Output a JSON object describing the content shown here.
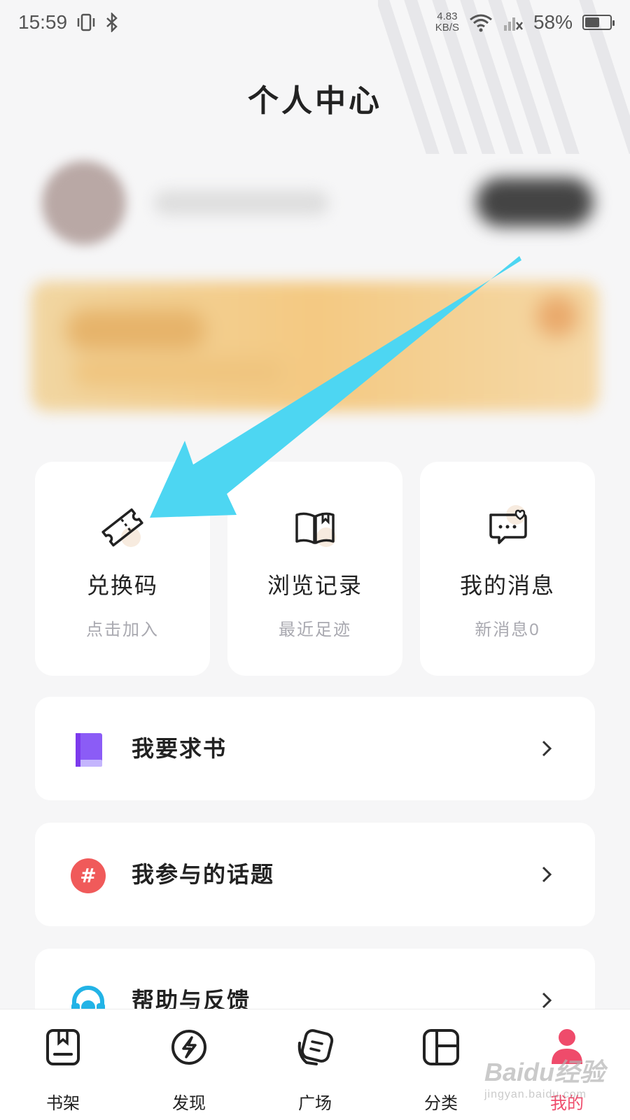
{
  "status_bar": {
    "time": "15:59",
    "speed_value": "4.83",
    "speed_unit": "KB/S",
    "battery": "58%",
    "battery_level": 0.58,
    "icons": [
      "vibrate-icon",
      "bluetooth-icon",
      "wifi-icon",
      "no-signal-icon",
      "battery-icon"
    ]
  },
  "header": {
    "title": "个人中心"
  },
  "quick_cards": [
    {
      "title": "兑换码",
      "subtitle": "点击加入",
      "icon": "ticket-icon"
    },
    {
      "title": "浏览记录",
      "subtitle": "最近足迹",
      "icon": "open-book-icon"
    },
    {
      "title": "我的消息",
      "subtitle": "新消息0",
      "icon": "chat-heart-icon"
    }
  ],
  "menu_items": [
    {
      "label": "我要求书",
      "icon": "purple-book-icon"
    },
    {
      "label": "我参与的话题",
      "icon": "hashtag-icon"
    },
    {
      "label": "帮助与反馈",
      "icon": "headset-icon"
    }
  ],
  "tab_bar": {
    "items": [
      {
        "label": "书架",
        "icon": "bookshelf-icon"
      },
      {
        "label": "发现",
        "icon": "discover-icon"
      },
      {
        "label": "广场",
        "icon": "square-icon"
      },
      {
        "label": "分类",
        "icon": "category-icon"
      },
      {
        "label": "我的",
        "icon": "profile-icon"
      }
    ],
    "active": "我的"
  },
  "colors": {
    "accent": "#ef4b6b",
    "arrow": "#4dd6f2",
    "purple": "#8b5cf6",
    "hashtag_red": "#f05a5a",
    "headset_blue": "#22b3e6"
  },
  "watermark": {
    "brand": "Baidu经验",
    "url": "jingyan.baidu.com"
  }
}
